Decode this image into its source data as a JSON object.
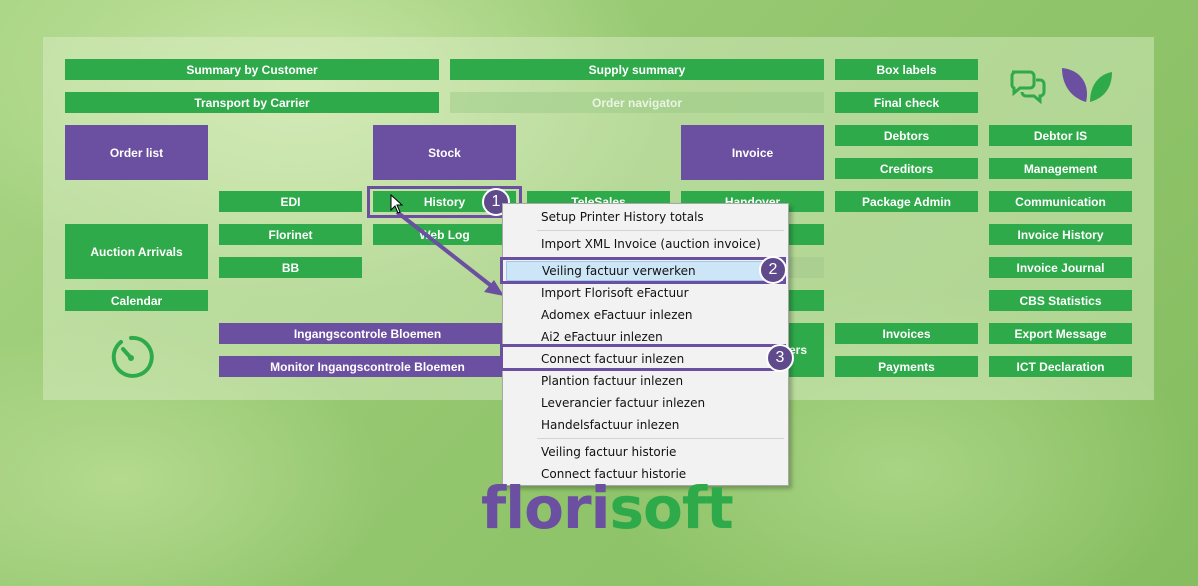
{
  "buttons": {
    "summary_by_customer": "Summary by Customer",
    "supply_summary": "Supply summary",
    "box_labels": "Box labels",
    "transport_by_carrier": "Transport by Carrier",
    "order_navigator": "Order navigator",
    "final_check": "Final check",
    "order_list": "Order list",
    "stock": "Stock",
    "invoice": "Invoice",
    "debtors": "Debtors",
    "debtor_is": "Debtor IS",
    "creditors": "Creditors",
    "management": "Management",
    "edi": "EDI",
    "history": "History",
    "telesales": "TeleSales",
    "handover": "Handover",
    "package_admin": "Package Admin",
    "communication": "Communication",
    "auction_arrivals": "Auction Arrivals",
    "florinet": "Florinet",
    "web_log": "Web Log",
    "invoice_history": "Invoice History",
    "bb": "BB",
    "invoice_journal": "Invoice Journal",
    "calendar": "Calendar",
    "cbs_statistics": "CBS Statistics",
    "ingangscontrole": "Ingangscontrole Bloemen",
    "monitor_ingangscontrole": "Monitor Ingangscontrole Bloemen",
    "orders": "Orders",
    "invoices": "Invoices",
    "export_message": "Export Message",
    "payments": "Payments",
    "ict_declaration": "ICT Declaration"
  },
  "context_menu": {
    "items": [
      "Setup Printer History totals",
      "Import XML Invoice (auction invoice)",
      "Veiling factuur verwerken",
      "Import Florisoft eFactuur",
      "Adomex eFactuur inlezen",
      "Ai2 eFactuur inlezen",
      "Connect factuur inlezen",
      "Plantion factuur inlezen",
      "Leverancier factuur inlezen",
      "Handelsfactuur inlezen",
      "Veiling factuur historie",
      "Connect factuur historie"
    ],
    "highlighted_index": 2
  },
  "callouts": [
    "1",
    "2",
    "3"
  ],
  "logo": {
    "part1": "flori",
    "part2": "soft"
  },
  "colors": {
    "green": "#2faa4a",
    "purple": "#6b4fa0",
    "menu_highlight": "#cde6f7"
  },
  "icons": [
    "chat-bubbles-icon",
    "leaves-icon",
    "timer-icon",
    "mouse-cursor-icon"
  ]
}
